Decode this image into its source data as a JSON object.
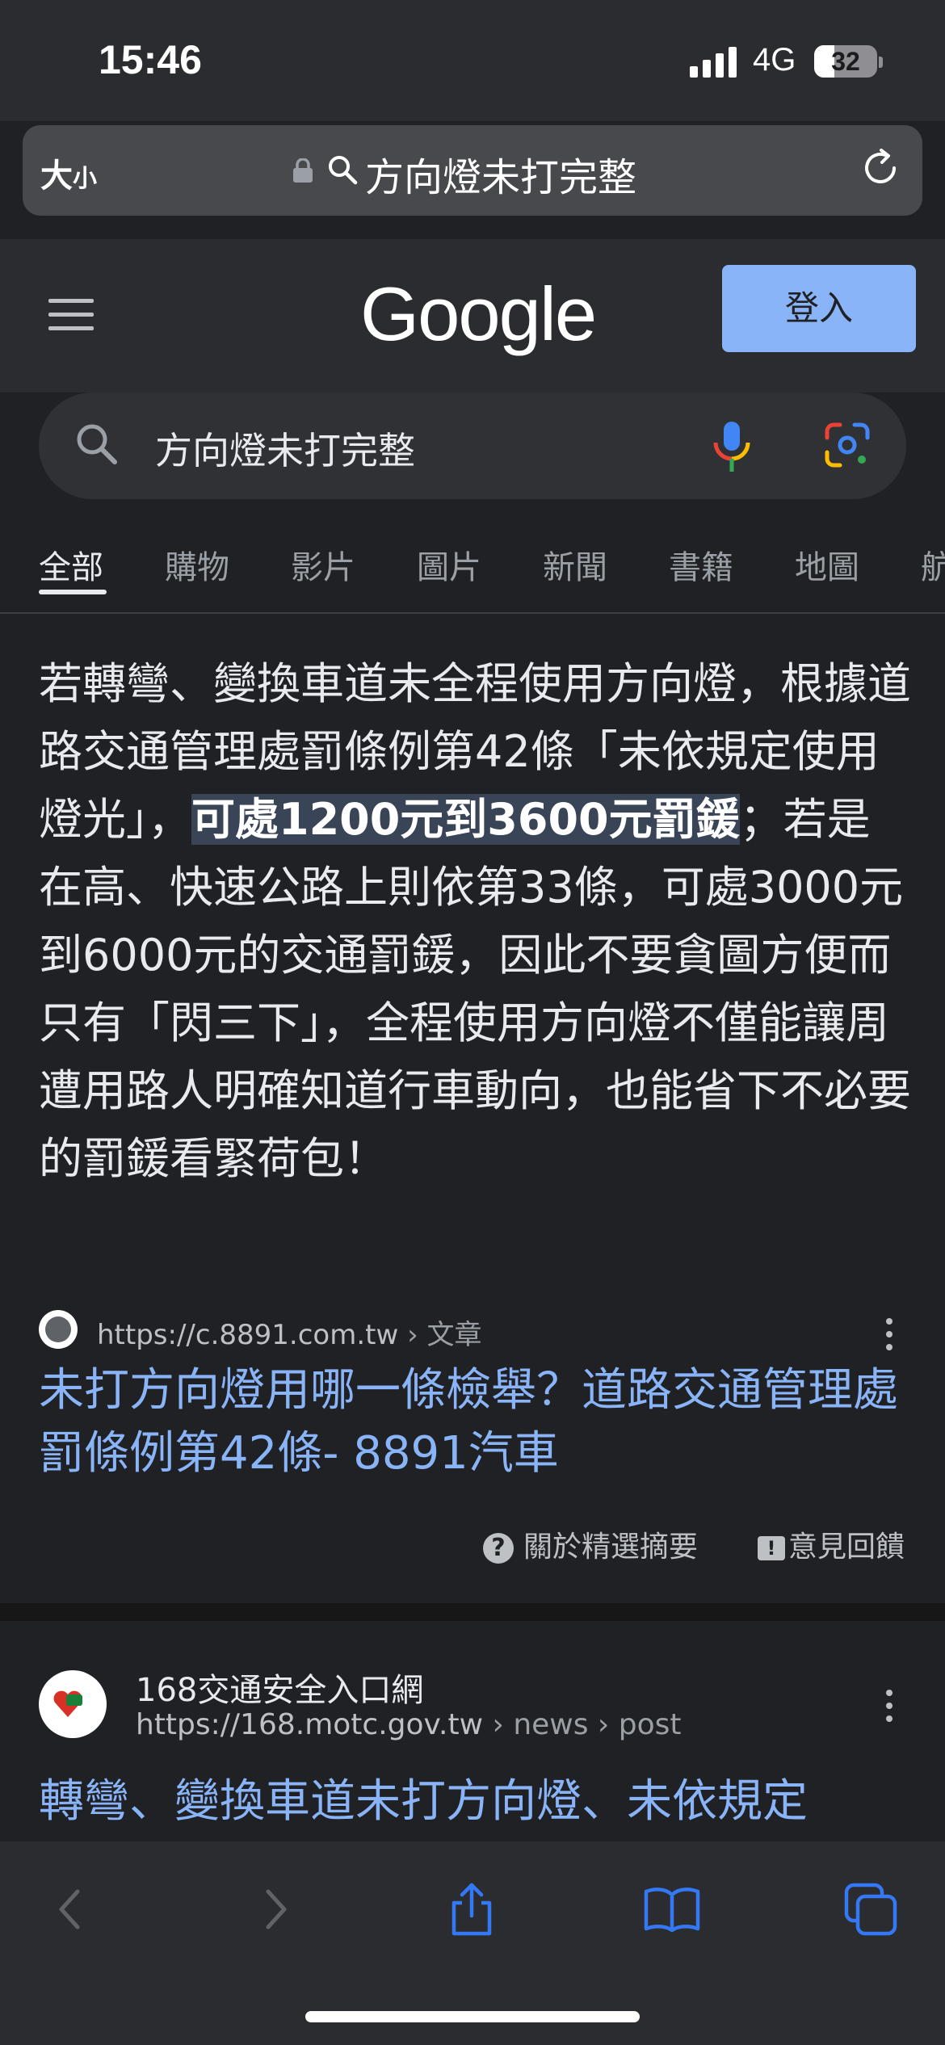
{
  "status_bar": {
    "time": "15:46",
    "network": "4G",
    "battery": "32",
    "battery_level": 0.32
  },
  "address_bar": {
    "text_size_big": "大",
    "text_size_small": "小",
    "query": "方向燈未打完整"
  },
  "header": {
    "logo": "Google",
    "signin_label": "登入"
  },
  "search": {
    "query": "方向燈未打完整"
  },
  "tabs": [
    {
      "label": "全部",
      "active": true
    },
    {
      "label": "購物"
    },
    {
      "label": "影片"
    },
    {
      "label": "圖片"
    },
    {
      "label": "新聞"
    },
    {
      "label": "書籍"
    },
    {
      "label": "地圖"
    },
    {
      "label": "航"
    }
  ],
  "featured_snippet": {
    "text_before": "若轉彎、變換車道未全程使用方向燈，根據道路交通管理處罰條例第42條「未依規定使用燈光」，",
    "highlight": "可處1200元到3600元罰鍰",
    "text_after": "；若是在高、快速公路上則依第33條，可處3000元到6000元的交通罰鍰，因此不要貪圖方便而只有「閃三下」，全程使用方向燈不僅能讓周遭用路人明確知道行車動向，也能省下不必要的罰鍰看緊荷包！",
    "source_url": "https://c.8891.com.tw",
    "source_breadcrumb": " › 文章",
    "title": "未打方向燈用哪一條檢舉？道路交通管理處罰條例第42條- 8891汽車",
    "about_label": "關於精選摘要",
    "feedback_label": "意見回饋",
    "about_glyph": "?",
    "feedback_glyph": "!"
  },
  "result2": {
    "site_name": "168交通安全入口網",
    "url": "https://168.motc.gov.tw",
    "breadcrumb": " › news › post",
    "title": "轉彎、變換車道未打方向燈、未依規定"
  },
  "colors": {
    "background": "#202124",
    "link": "#8ab4f8",
    "signin_bg": "#8ab4f8",
    "highlight_bg": "#394457",
    "toolbar_icon": "#3478f6"
  }
}
